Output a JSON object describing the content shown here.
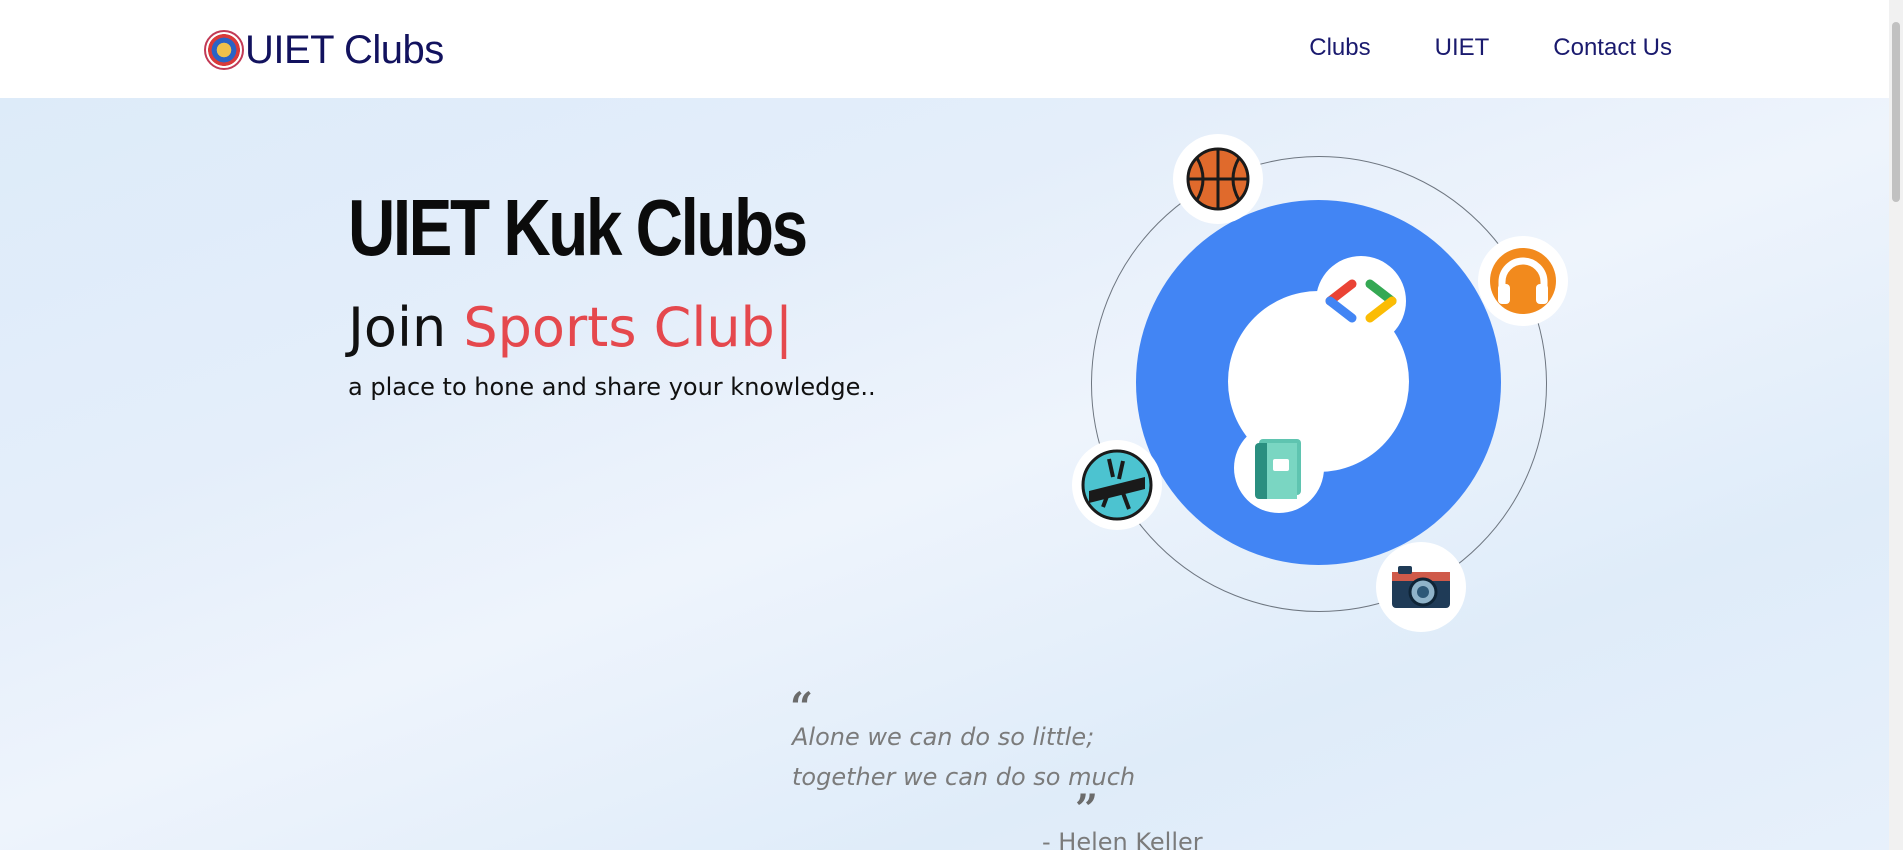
{
  "navbar": {
    "brand": "UIET Clubs",
    "links": [
      "Clubs",
      "UIET",
      "Contact Us"
    ]
  },
  "hero": {
    "title": "UIET Kuk Clubs",
    "join_prefix": "Join ",
    "join_typed": "Sports Club",
    "cursor": "|",
    "subtitle": "a place to hone and share your knowledge.."
  },
  "orbit": {
    "icons": [
      "basketball-icon",
      "code-icon",
      "headphones-icon",
      "book-icon",
      "dance-icon",
      "camera-icon"
    ],
    "colors": {
      "main_circle": "#4285f4",
      "accent": "#e5484d"
    }
  },
  "quote": {
    "open_mark": "“",
    "line1": "Alone we can do so little;",
    "line2": "together we can do so much",
    "close_mark": "”",
    "author": "- Helen Keller"
  }
}
